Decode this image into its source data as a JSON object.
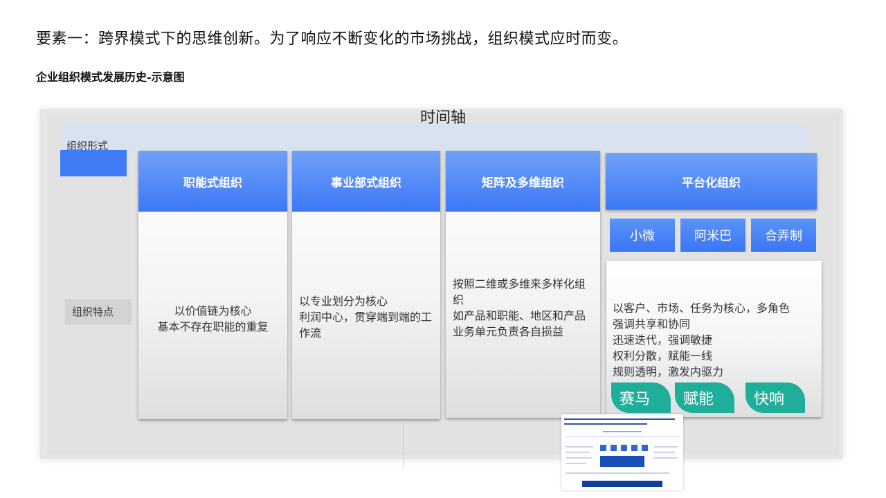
{
  "heading": "要素一：跨界模式下的思维创新。为了响应不断变化的市场挑战，组织模式应时而变。",
  "subheading": "企业组织模式发展历史-示意图",
  "diagram": {
    "timeline_title": "时间轴",
    "row_labels": {
      "form": "组织形式",
      "features": "组织特点"
    },
    "columns": [
      {
        "title": "职能式组织",
        "body": [
          "以价值链为核心",
          "基本不存在职能的重复"
        ]
      },
      {
        "title": "事业部式组织",
        "body": [
          "以专业划分为核心",
          "利润中心，贯穿端到端的工",
          "作流"
        ]
      },
      {
        "title": "矩阵及多维组织",
        "body": [
          "按照二维或多维来多样化组",
          "织",
          "如产品和职能、地区和产品",
          "业务单元负责各自损益"
        ]
      },
      {
        "title": "平台化组织",
        "body": [
          "以客户、市场、任务为核心，多角色",
          "强调共享和协同",
          "迅速迭代，强调敏捷",
          "权利分散，赋能一线",
          "规则透明，激发内驱力"
        ]
      }
    ],
    "platform_examples": [
      "小微",
      "阿米巴",
      "合弄制"
    ],
    "platform_tags": [
      "赛马",
      "赋能",
      "快响"
    ],
    "accent_color": "#3d78f6",
    "tag_color": "#1fae9a"
  }
}
